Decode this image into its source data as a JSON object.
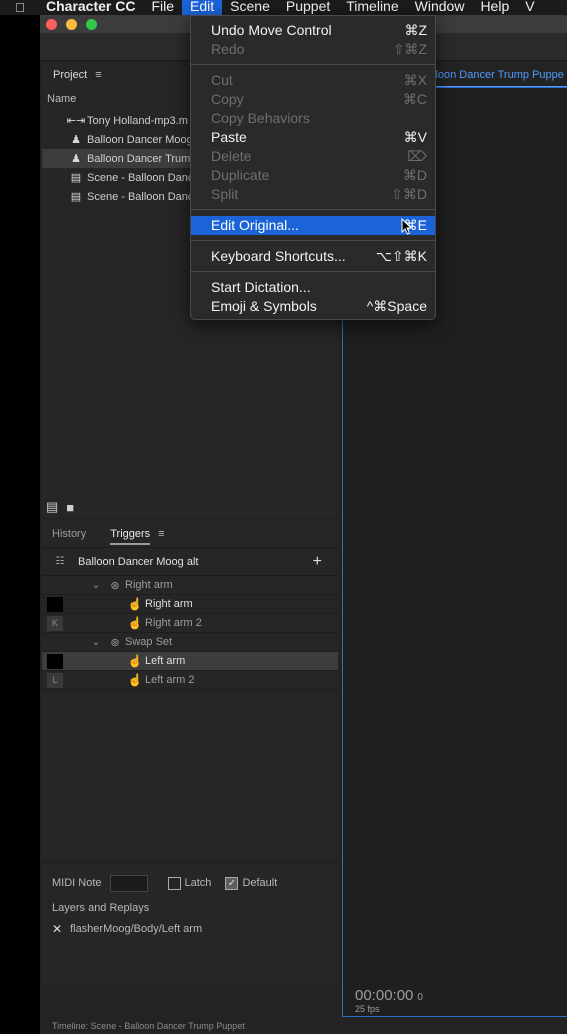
{
  "menubar": {
    "apple": "",
    "app_name": "Character CC",
    "items": [
      "File",
      "Edit",
      "Scene",
      "Puppet",
      "Timeline",
      "Window",
      "Help",
      "V"
    ]
  },
  "project": {
    "title": "Project",
    "column_name": "Name",
    "items": [
      {
        "icon": "audio-icon",
        "label": "Tony Holland-mp3.m"
      },
      {
        "icon": "puppet-icon",
        "label": "Balloon Dancer Moog"
      },
      {
        "icon": "puppet-icon",
        "label": "Balloon Dancer Trum"
      },
      {
        "icon": "scene-icon",
        "label": "Scene - Balloon Danc"
      },
      {
        "icon": "scene-icon",
        "label": "Scene - Balloon Danc"
      }
    ]
  },
  "triggers_panel": {
    "tabs": [
      "History",
      "Triggers"
    ],
    "active_tab": "Triggers",
    "puppet_name": "Balloon Dancer Moog alt",
    "rows": [
      {
        "type": "group",
        "key": "",
        "label": "Right arm"
      },
      {
        "type": "trigger",
        "key": "",
        "label": "Right arm"
      },
      {
        "type": "trigger",
        "key": "K",
        "label": "Right arm 2"
      },
      {
        "type": "group",
        "key": "",
        "label": "Swap Set"
      },
      {
        "type": "trigger",
        "key": "",
        "label": "Left arm"
      },
      {
        "type": "trigger",
        "key": "L",
        "label": "Left arm 2"
      }
    ]
  },
  "properties": {
    "midi_label": "MIDI Note",
    "latch_label": "Latch",
    "latch_checked": false,
    "default_label": "Default",
    "default_checked": true,
    "layers_label": "Layers and Replays",
    "layer_path": "flasherMoog/Body/Left arm"
  },
  "scene": {
    "tab_label": "lloon Dancer Trump Puppe",
    "timecode": "00:00:00",
    "frame": "0",
    "fps": "25 fps"
  },
  "bottom_strip": "Timeline: Scene - Balloon Dancer Trump Puppet",
  "edit_menu": {
    "undo": {
      "label": "Undo Move Control",
      "shortcut": "⌘Z"
    },
    "redo": {
      "label": "Redo",
      "shortcut": "⇧⌘Z"
    },
    "cut": {
      "label": "Cut",
      "shortcut": "⌘X"
    },
    "copy": {
      "label": "Copy",
      "shortcut": "⌘C"
    },
    "copy_behaviors": {
      "label": "Copy Behaviors",
      "shortcut": ""
    },
    "paste": {
      "label": "Paste",
      "shortcut": "⌘V"
    },
    "delete": {
      "label": "Delete",
      "shortcut": "⌦"
    },
    "duplicate": {
      "label": "Duplicate",
      "shortcut": "⌘D"
    },
    "split": {
      "label": "Split",
      "shortcut": "⇧⌘D"
    },
    "edit_original": {
      "label": "Edit Original...",
      "shortcut": "⌘E"
    },
    "keyboard_shortcuts": {
      "label": "Keyboard Shortcuts...",
      "shortcut": "⌥⇧⌘K"
    },
    "start_dictation": {
      "label": "Start Dictation...",
      "shortcut": ""
    },
    "emoji_symbols": {
      "label": "Emoji & Symbols",
      "shortcut": "^⌘Space"
    }
  },
  "colors": {
    "menu_highlight": "#1b63d6",
    "scene_accent": "#4d9bff",
    "panel_bg": "#262626"
  }
}
